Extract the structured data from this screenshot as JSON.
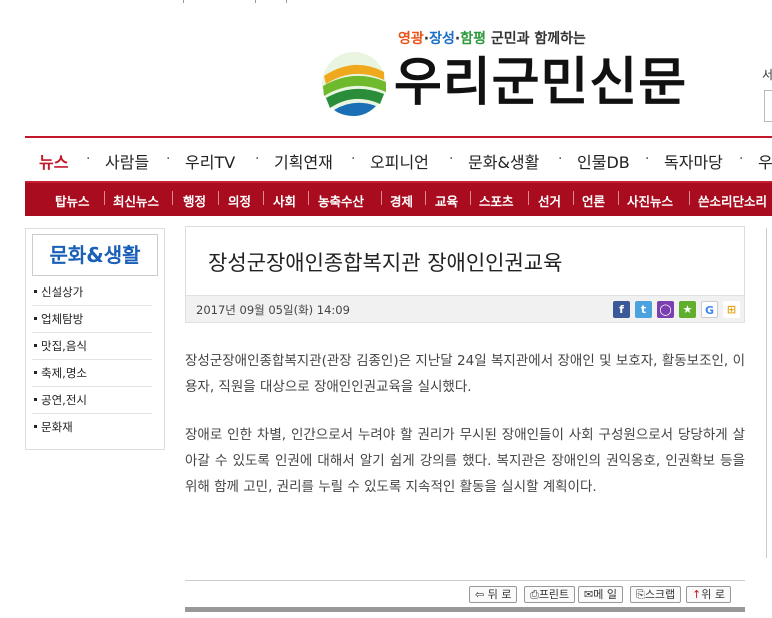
{
  "header": {
    "tagline_a": "영광",
    "tagline_b": "장성",
    "tagline_c": "함평",
    "tagline_dot": "·",
    "tagline_rest": "군민과 함께하는",
    "logo_text": "우리군민신문",
    "side_fragment": "서"
  },
  "main_nav": [
    {
      "label": "뉴스",
      "active": true
    },
    {
      "label": "사람들"
    },
    {
      "label": "우리TV"
    },
    {
      "label": "기획연재"
    },
    {
      "label": "오피니언"
    },
    {
      "label": "문화&생활"
    },
    {
      "label": "인물DB"
    },
    {
      "label": "독자마당"
    },
    {
      "label": "우"
    }
  ],
  "sub_nav": [
    "탑뉴스",
    "최신뉴스",
    "행정",
    "의정",
    "사회",
    "농축수산",
    "경제",
    "교육",
    "스포츠",
    "선거",
    "언론",
    "사진뉴스",
    "쓴소리단소리"
  ],
  "sidebar": {
    "title": "문화&생활",
    "items": [
      "신설상가",
      "업체탐방",
      "맛집,음식",
      "축제,명소",
      "공연,전시",
      "문화재"
    ]
  },
  "article": {
    "title": "장성군장애인종합복지관 장애인인권교육",
    "date": "2017년 09월 05일(화) 14:09",
    "paragraphs": [
      "장성군장애인종합복지관(관장 김종인)은 지난달 24일 복지관에서 장애인 및 보호자, 활동보조인, 이용자, 직원을 대상으로 장애인인권교육을 실시했다.",
      "장애로 인한 차별, 인간으로서 누려야 할 권리가 무시된 장애인들이 사회 구성원으로서 당당하게 살아갈 수 있도록 인권에 대해서 알기 쉽게 강의를 했다. 복지관은 장애인의 권익옹호, 인권확보 등을 위해 함께 고민, 권리를 누릴 수 있도록 지속적인 활동을 실시할 계획이다."
    ]
  },
  "share_icons": [
    {
      "name": "facebook-icon",
      "glyph": "f",
      "color": "#3b5998"
    },
    {
      "name": "twitter-icon",
      "glyph": "t",
      "color": "#4aa3df"
    },
    {
      "name": "chat-icon",
      "glyph": "◯",
      "color": "#7a3fb0"
    },
    {
      "name": "star-icon",
      "glyph": "★",
      "color": "#5fae2e"
    },
    {
      "name": "google-icon",
      "glyph": "G",
      "color": "#4285f4"
    },
    {
      "name": "windows-icon",
      "glyph": "⊞",
      "color": "#e8a21b"
    }
  ],
  "tools": [
    {
      "name": "back-button",
      "icon": "⇦",
      "label": "뒤 로"
    },
    {
      "name": "print-button",
      "icon": "⎙",
      "label": "프린트"
    },
    {
      "name": "email-button",
      "icon": "✉",
      "label": "메 일"
    },
    {
      "name": "scrap-button",
      "icon": "⎘",
      "label": "스크랩"
    },
    {
      "name": "top-button",
      "icon": "↑",
      "label": "위 로"
    }
  ],
  "colors": {
    "brand_red": "#a80c1e",
    "nav_active": "#c2182a",
    "sidebar_title": "#1a5fb8"
  }
}
